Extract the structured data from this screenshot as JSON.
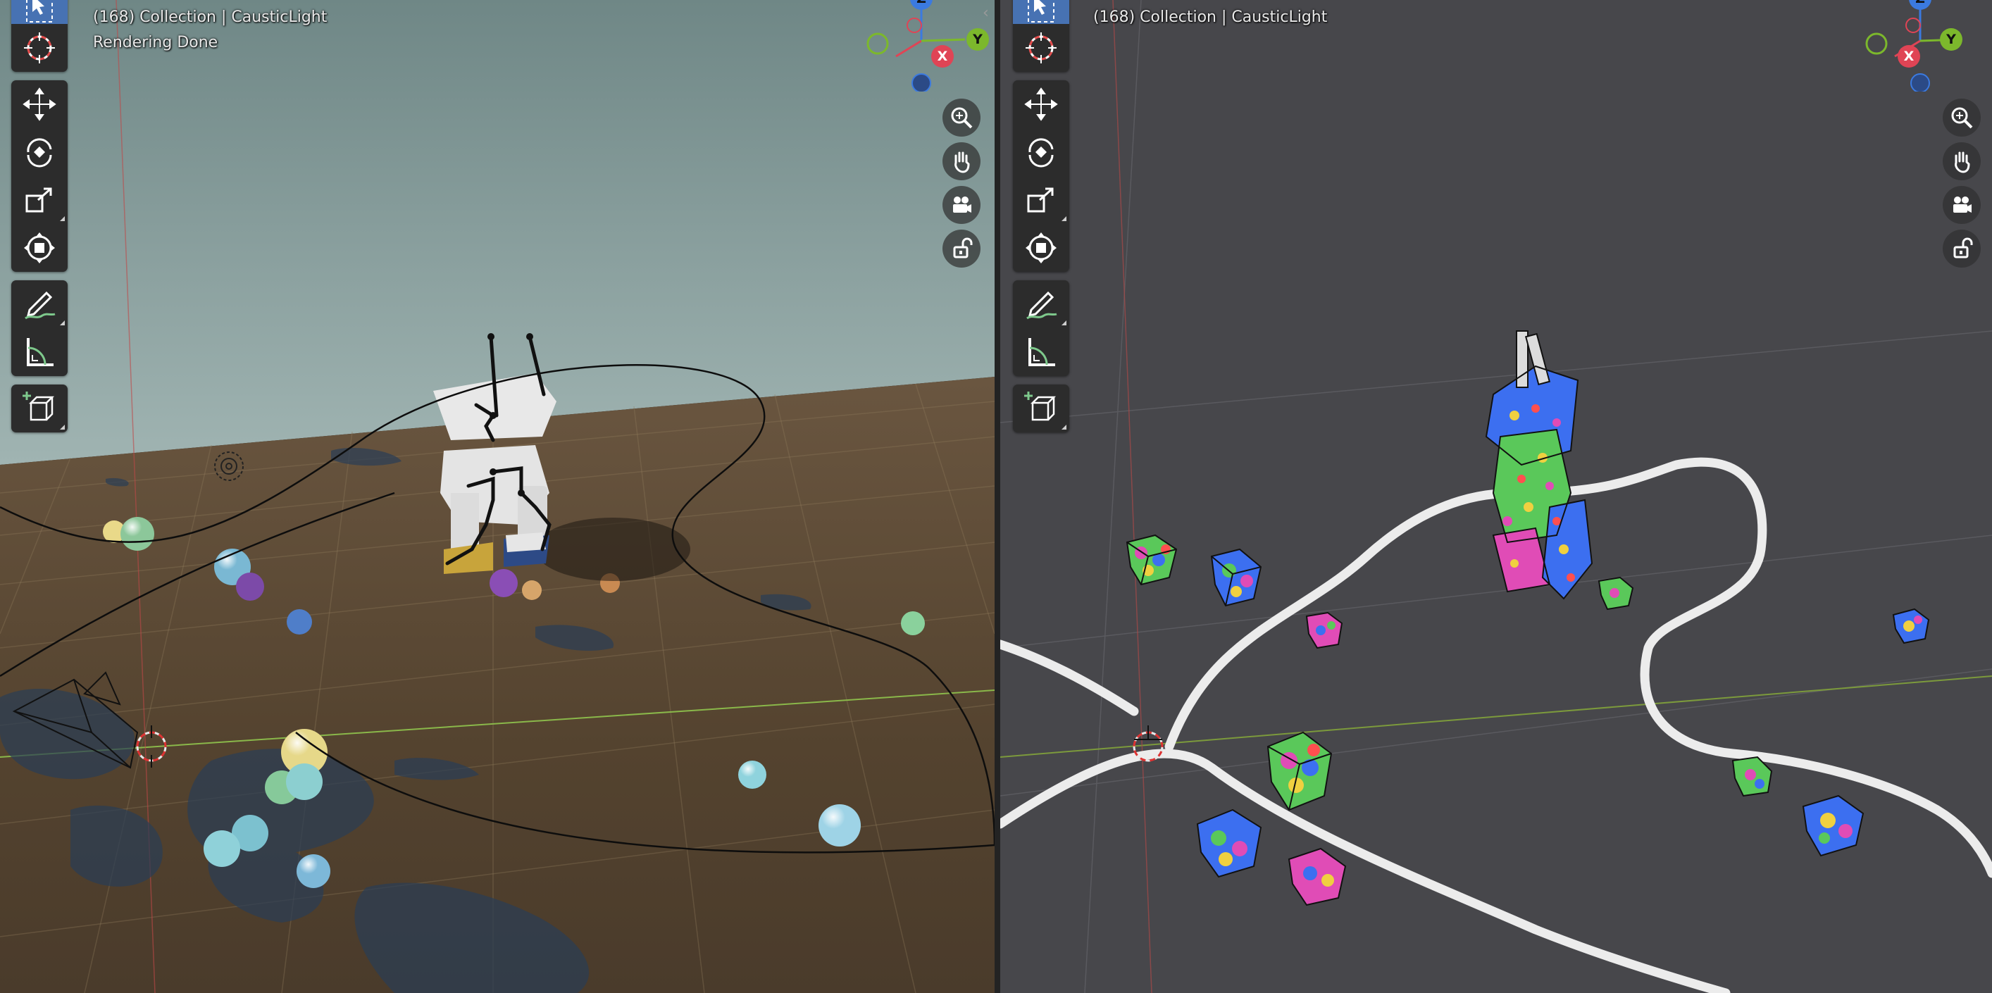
{
  "viewports": {
    "left": {
      "title": "(168) Collection | CausticLight",
      "status": "Rendering Done",
      "mode": "rendered"
    },
    "right": {
      "title": "(168) Collection | CausticLight",
      "mode": "solid"
    }
  },
  "toolbar": [
    {
      "name": "select-box",
      "icon": "cursor-arrow-icon",
      "active": true
    },
    {
      "name": "cursor",
      "icon": "3d-cursor-icon"
    },
    {
      "name": "move",
      "icon": "move-arrows-icon"
    },
    {
      "name": "rotate",
      "icon": "rotate-icon"
    },
    {
      "name": "scale",
      "icon": "scale-icon"
    },
    {
      "name": "transform",
      "icon": "transform-icon"
    },
    {
      "name": "annotate",
      "icon": "pencil-icon"
    },
    {
      "name": "measure",
      "icon": "ruler-icon"
    },
    {
      "name": "add-cube",
      "icon": "add-cube-icon"
    }
  ],
  "navigation": [
    {
      "name": "zoom",
      "icon": "zoom-icon"
    },
    {
      "name": "pan",
      "icon": "hand-icon"
    },
    {
      "name": "camera-view",
      "icon": "camera-icon"
    },
    {
      "name": "lock",
      "icon": "lock-icon"
    }
  ],
  "gizmo": {
    "x_label": "X",
    "y_label": "Y",
    "z_label": "Z",
    "x_color": "#e04455",
    "y_color": "#7cb82c",
    "z_color": "#3b7ae0"
  },
  "colors": {
    "wall": "#7f9796",
    "floor": "#5e4d38",
    "grid_bg": "#4a4a4e",
    "tool_active": "#4772b3",
    "path_tube": "#e8e8e8"
  }
}
